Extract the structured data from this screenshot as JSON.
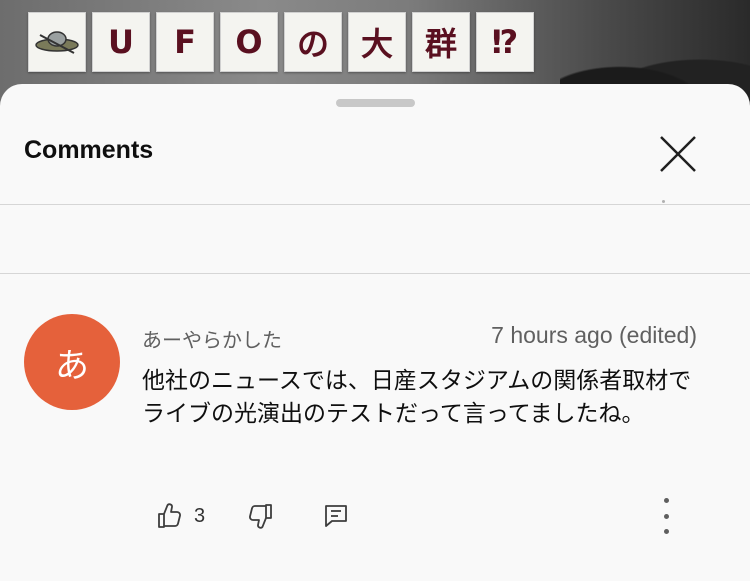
{
  "video": {
    "title_chars": [
      "U",
      "F",
      "O",
      "の",
      "大",
      "群",
      "⁉"
    ]
  },
  "sheet": {
    "title": "Comments"
  },
  "comment": {
    "avatar_letter": "あ",
    "avatar_color": "#e5613b",
    "author": "あーやらかした",
    "timestamp": "7 hours ago (edited)",
    "text": "他社のニュースでは、日産スタジアムの関係者取材でライブの光演出のテストだって言ってましたね。",
    "like_count": "3"
  },
  "icons": {
    "ufo": "ufo-icon",
    "close": "close-icon",
    "like": "thumbs-up-icon",
    "dislike": "thumbs-down-icon",
    "reply": "reply-icon",
    "more": "more-vert-icon"
  }
}
